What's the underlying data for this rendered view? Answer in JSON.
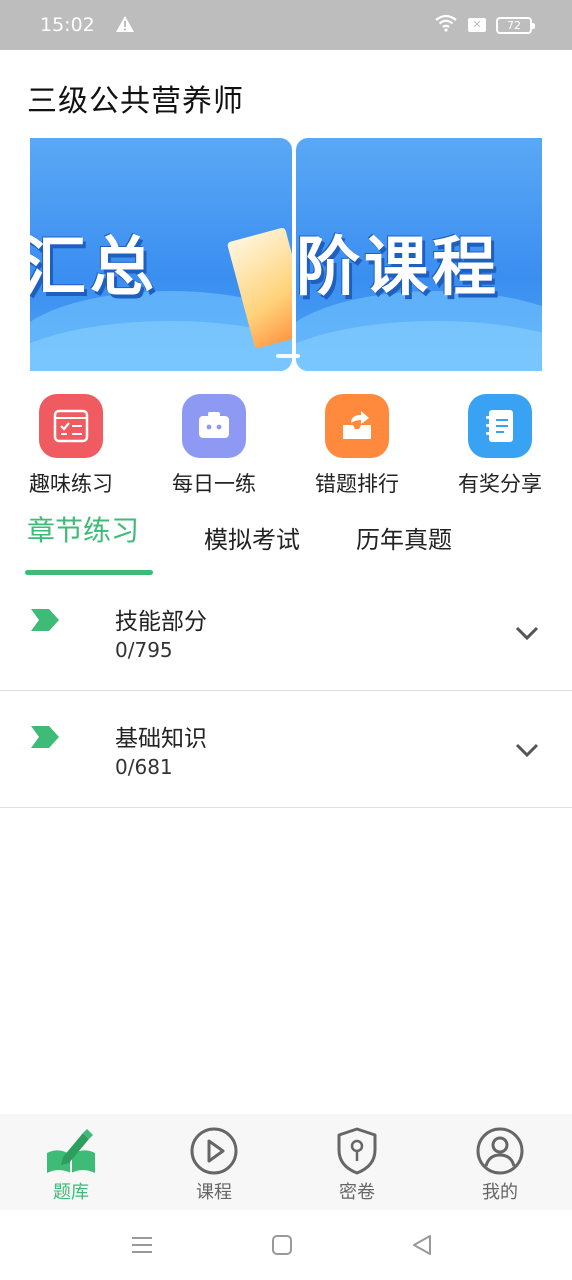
{
  "status_bar": {
    "time": "15:02",
    "battery": "72",
    "icons": [
      "warning-icon",
      "wifi-icon",
      "sim-off-icon",
      "battery-icon"
    ]
  },
  "page_title": "三级公共营养师",
  "banner": {
    "slides": [
      {
        "text": "汇总"
      },
      {
        "text": "阶课程"
      }
    ]
  },
  "quick_entries": [
    {
      "label": "趣味练习",
      "icon": "practice-list-icon",
      "color": "#f05a61"
    },
    {
      "label": "每日一练",
      "icon": "robot-icon",
      "color": "#8e99f3"
    },
    {
      "label": "错题排行",
      "icon": "share-box-icon",
      "color": "#ff8a3d"
    },
    {
      "label": "有奖分享",
      "icon": "notebook-icon",
      "color": "#3aa2f2"
    }
  ],
  "tabs": [
    {
      "label": "章节练习",
      "active": true
    },
    {
      "label": "模拟考试",
      "active": false
    },
    {
      "label": "历年真题",
      "active": false
    }
  ],
  "chapters": [
    {
      "name": "技能部分",
      "progress": "0/795"
    },
    {
      "name": "基础知识",
      "progress": "0/681"
    }
  ],
  "bottom_nav": [
    {
      "label": "题库",
      "icon": "question-bank-icon",
      "active": true
    },
    {
      "label": "课程",
      "icon": "play-circle-icon",
      "active": false
    },
    {
      "label": "密卷",
      "icon": "shield-key-icon",
      "active": false
    },
    {
      "label": "我的",
      "icon": "user-circle-icon",
      "active": false
    }
  ],
  "colors": {
    "accent": "#3dbb77",
    "status_bar": "#bdbdbd",
    "text": "#222222"
  }
}
